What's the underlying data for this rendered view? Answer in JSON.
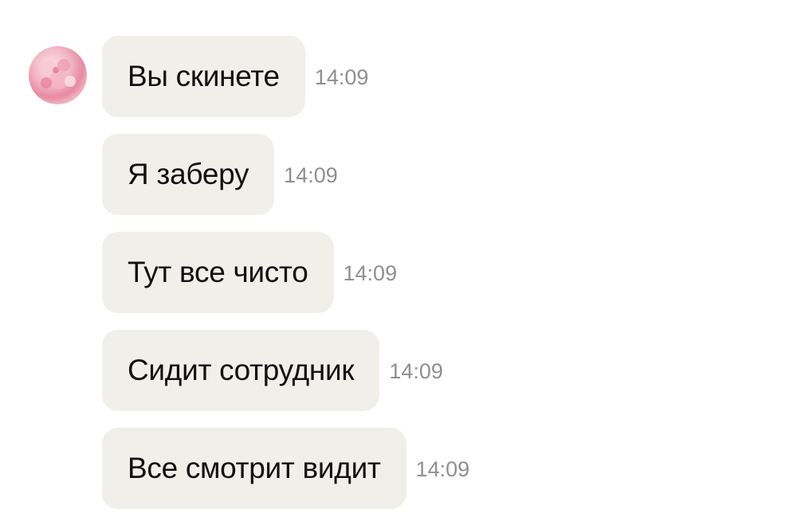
{
  "chat": {
    "avatar_icon": "profile-avatar-pink-flowers",
    "bubble_color": "#f1efea",
    "time_color": "#8f8f8f",
    "messages": [
      {
        "text": "Вы скинете",
        "time": "14:09"
      },
      {
        "text": "Я заберу",
        "time": "14:09"
      },
      {
        "text": "Тут все чисто",
        "time": "14:09"
      },
      {
        "text": "Сидит сотрудник",
        "time": "14:09"
      },
      {
        "text": "Все смотрит видит",
        "time": "14:09"
      }
    ]
  }
}
